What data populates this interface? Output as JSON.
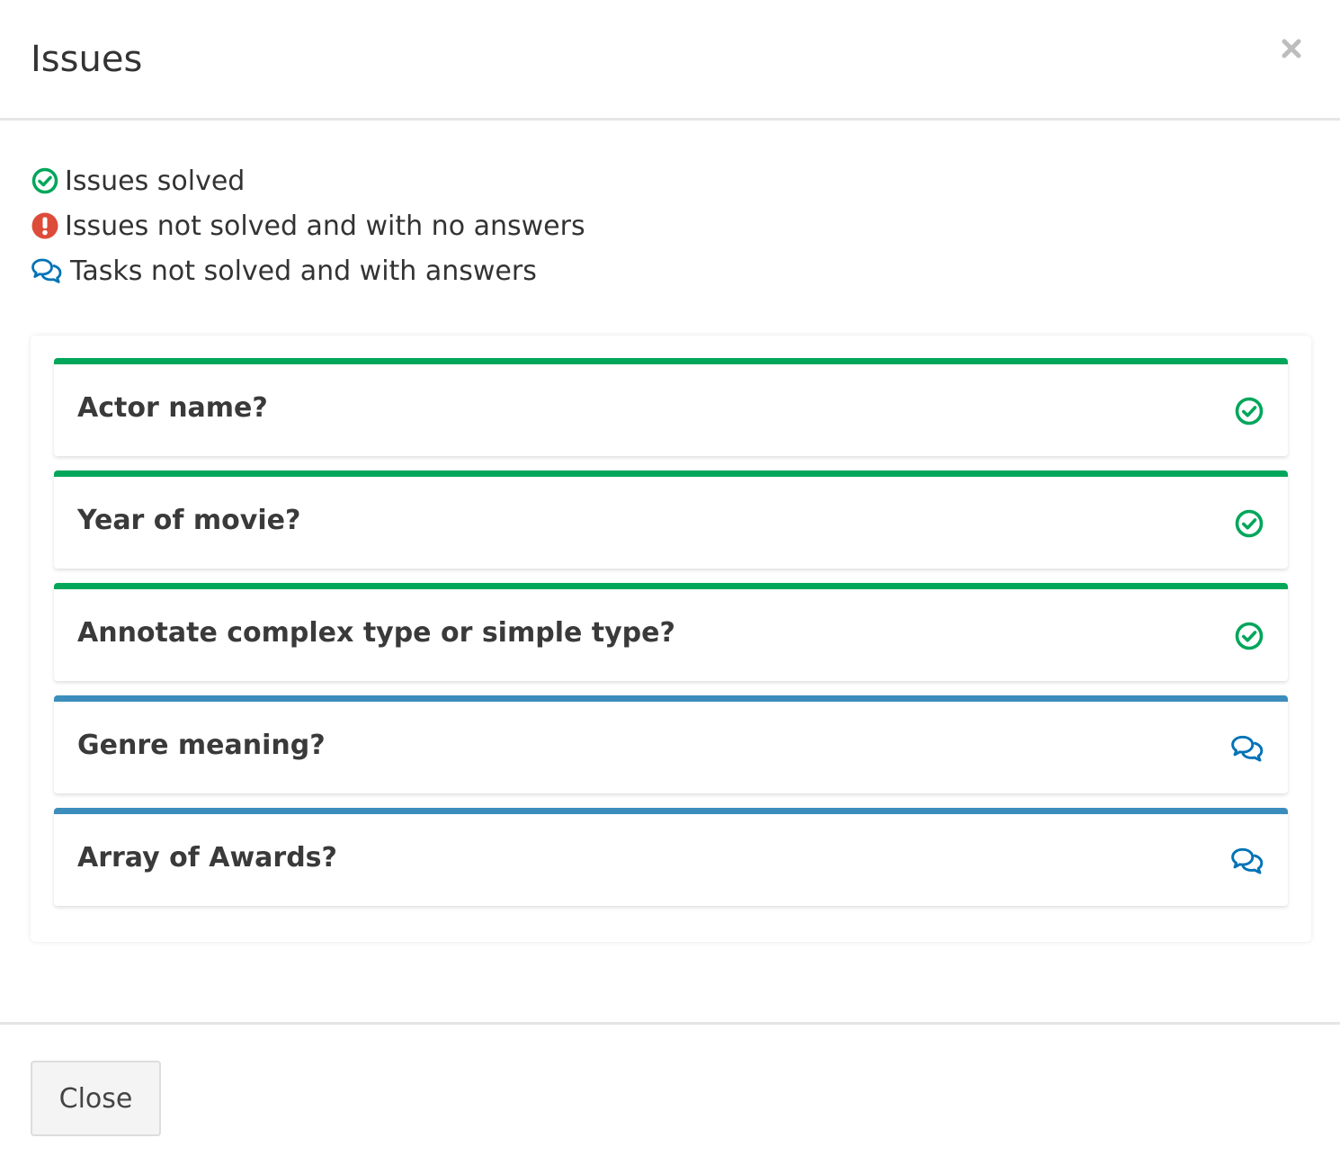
{
  "modal": {
    "title": "Issues",
    "close_icon": "times-icon"
  },
  "legend": [
    {
      "icon": "check-circle-icon",
      "color": "#00a65a",
      "label": "Issues solved"
    },
    {
      "icon": "exclamation-circle-icon",
      "color": "#dd4b39",
      "label": "Issues not solved and with no answers"
    },
    {
      "icon": "comments-icon",
      "color": "#0073b7",
      "label": "Tasks not solved and with answers"
    }
  ],
  "issues": [
    {
      "title": "Actor name?",
      "status": "solved",
      "status_icon": "check-circle-icon",
      "bar_color": "#00a65a"
    },
    {
      "title": "Year of movie?",
      "status": "solved",
      "status_icon": "check-circle-icon",
      "bar_color": "#00a65a"
    },
    {
      "title": "Annotate complex type or simple type?",
      "status": "solved",
      "status_icon": "check-circle-icon",
      "bar_color": "#00a65a"
    },
    {
      "title": "Genre meaning?",
      "status": "not-solved-with-answers",
      "status_icon": "comments-icon",
      "bar_color": "#3c8dbc"
    },
    {
      "title": "Array of Awards?",
      "status": "not-solved-with-answers",
      "status_icon": "comments-icon",
      "bar_color": "#3c8dbc"
    }
  ],
  "footer": {
    "close_label": "Close"
  },
  "colors": {
    "solved": "#00a65a",
    "not_solved": "#dd4b39",
    "answered": "#0073b7",
    "answered_bar": "#3c8dbc"
  }
}
